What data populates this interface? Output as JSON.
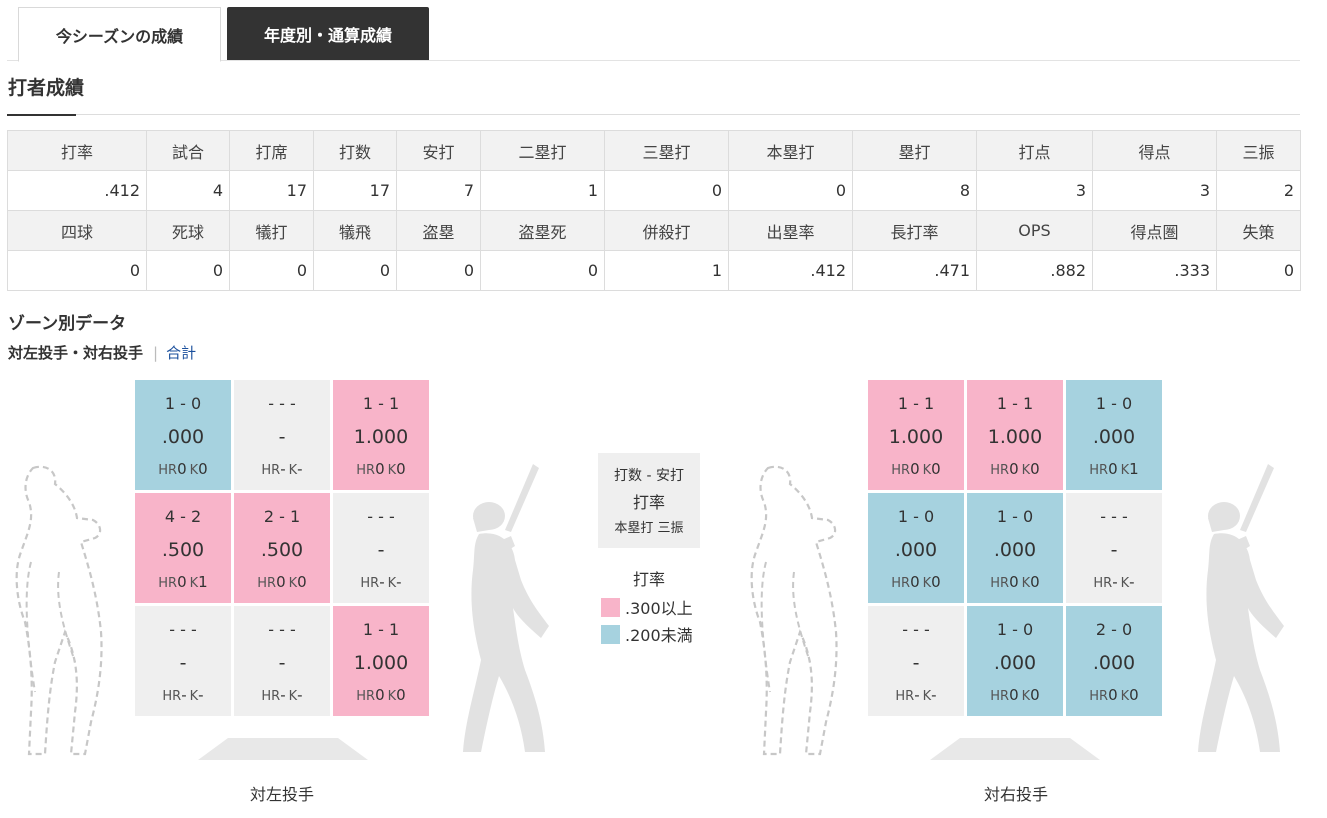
{
  "tabs": [
    {
      "label": "今シーズンの成績",
      "active": true
    },
    {
      "label": "年度別・通算成績",
      "active": false
    }
  ],
  "section_title": "打者成績",
  "stats": {
    "row1_headers": [
      "打率",
      "試合",
      "打席",
      "打数",
      "安打",
      "二塁打",
      "三塁打",
      "本塁打",
      "塁打",
      "打点",
      "得点",
      "三振"
    ],
    "row1_values": [
      ".412",
      "4",
      "17",
      "17",
      "7",
      "1",
      "0",
      "0",
      "8",
      "3",
      "3",
      "2"
    ],
    "row2_headers": [
      "四球",
      "死球",
      "犠打",
      "犠飛",
      "盗塁",
      "盗塁死",
      "併殺打",
      "出塁率",
      "長打率",
      "OPS",
      "得点圏",
      "失策"
    ],
    "row2_values": [
      "0",
      "0",
      "0",
      "0",
      "0",
      "0",
      "1",
      ".412",
      ".471",
      ".882",
      ".333",
      "0"
    ]
  },
  "zone": {
    "title": "ゾーン別データ",
    "filter_active": "対左投手・対右投手",
    "filter_separator": "|",
    "filter_link": "合計",
    "left_caption": "対左投手",
    "right_caption": "対右投手",
    "hr_label": "HR",
    "k_label": "K",
    "left_cells": [
      {
        "ab": "1 - 0",
        "avg": ".000",
        "hr": "0",
        "k": "0",
        "color": "blue"
      },
      {
        "ab": "- - -",
        "avg": "-",
        "hr": "-",
        "k": "-",
        "color": "gray"
      },
      {
        "ab": "1 - 1",
        "avg": "1.000",
        "hr": "0",
        "k": "0",
        "color": "pink"
      },
      {
        "ab": "4 - 2",
        "avg": ".500",
        "hr": "0",
        "k": "1",
        "color": "pink"
      },
      {
        "ab": "2 - 1",
        "avg": ".500",
        "hr": "0",
        "k": "0",
        "color": "pink"
      },
      {
        "ab": "- - -",
        "avg": "-",
        "hr": "-",
        "k": "-",
        "color": "gray"
      },
      {
        "ab": "- - -",
        "avg": "-",
        "hr": "-",
        "k": "-",
        "color": "gray"
      },
      {
        "ab": "- - -",
        "avg": "-",
        "hr": "-",
        "k": "-",
        "color": "gray"
      },
      {
        "ab": "1 - 1",
        "avg": "1.000",
        "hr": "0",
        "k": "0",
        "color": "pink"
      }
    ],
    "right_cells": [
      {
        "ab": "1 - 1",
        "avg": "1.000",
        "hr": "0",
        "k": "0",
        "color": "pink"
      },
      {
        "ab": "1 - 1",
        "avg": "1.000",
        "hr": "0",
        "k": "0",
        "color": "pink"
      },
      {
        "ab": "1 - 0",
        "avg": ".000",
        "hr": "0",
        "k": "1",
        "color": "blue"
      },
      {
        "ab": "1 - 0",
        "avg": ".000",
        "hr": "0",
        "k": "0",
        "color": "blue"
      },
      {
        "ab": "1 - 0",
        "avg": ".000",
        "hr": "0",
        "k": "0",
        "color": "blue"
      },
      {
        "ab": "- - -",
        "avg": "-",
        "hr": "-",
        "k": "-",
        "color": "gray"
      },
      {
        "ab": "- - -",
        "avg": "-",
        "hr": "-",
        "k": "-",
        "color": "gray"
      },
      {
        "ab": "1 - 0",
        "avg": ".000",
        "hr": "0",
        "k": "0",
        "color": "blue"
      },
      {
        "ab": "2 - 0",
        "avg": ".000",
        "hr": "0",
        "k": "0",
        "color": "blue"
      }
    ]
  },
  "legend": {
    "line1": "打数 - 安打",
    "line2": "打率",
    "line3": "本塁打 三振",
    "key_title": "打率",
    "high_label": ".300以上",
    "low_label": ".200未満"
  },
  "colors": {
    "pink": "#f8b4c9",
    "blue": "#a6d2df",
    "gray": "#efefef",
    "tab_dark": "#333333",
    "link": "#1a4f9c"
  }
}
